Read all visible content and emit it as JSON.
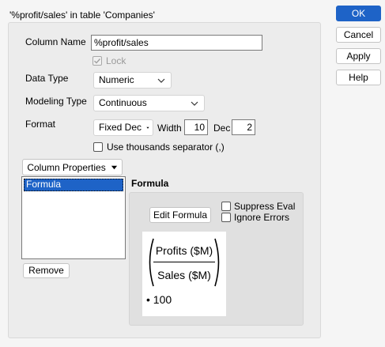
{
  "dialog": {
    "title": "'%profit/sales' in table 'Companies'"
  },
  "column_name": {
    "label": "Column Name",
    "value": "%profit/sales"
  },
  "lock": {
    "label": "Lock",
    "checked": true,
    "disabled": true
  },
  "data_type": {
    "label": "Data Type",
    "value": "Numeric"
  },
  "modeling_type": {
    "label": "Modeling Type",
    "value": "Continuous"
  },
  "format": {
    "label": "Format",
    "value": "Fixed Dec",
    "width_label": "Width",
    "width_value": "10",
    "dec_label": "Dec",
    "dec_value": "2"
  },
  "thousands": {
    "label": "Use thousands separator (,)",
    "checked": false
  },
  "column_properties": {
    "button_label": "Column Properties",
    "items": [
      "Formula"
    ],
    "selected": "Formula",
    "remove_label": "Remove"
  },
  "formula": {
    "heading": "Formula",
    "edit_label": "Edit Formula",
    "suppress_eval_label": "Suppress Eval",
    "ignore_errors_label": "Ignore Errors",
    "numerator": "Profits ($M)",
    "denominator": "Sales ($M)",
    "multiplier_symbol": "•",
    "multiplier": "100"
  },
  "actions": {
    "ok": "OK",
    "cancel": "Cancel",
    "apply": "Apply",
    "help": "Help"
  },
  "colors": {
    "accent": "#1e63c7"
  }
}
